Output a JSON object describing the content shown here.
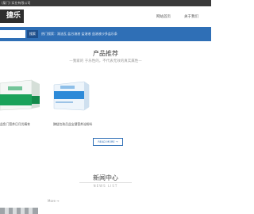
{
  "topbar": {
    "text": "(厦门) 实业有限公司"
  },
  "header": {
    "logo_text": "捷乐",
    "nav": [
      "网站首页",
      "关于我们"
    ]
  },
  "search": {
    "placeholder": "",
    "button_label": "搜索",
    "hot_text": "热门搜索：湖油瓦 盐谷溶液 盐溶液 益溶液沙多盐乐条"
  },
  "products": {
    "title": "产品推荐",
    "subtitle": "—我家的 于乐性的，不代表无效的真实属性—",
    "items": [
      {
        "name": "益鱼门营养日月优精育"
      },
      {
        "name": "酶链包装员益宝健营养淀粉料"
      }
    ],
    "read_more": "READ MORE →"
  },
  "news": {
    "title": "新闻中心",
    "subtitle": "NEWS LIST",
    "more": "More ➞"
  },
  "colors": {
    "accent": "#2f6fb6",
    "topbar": "#3a3a3a",
    "product_box_green": "#1aa25a",
    "product_box_blue": "#2d8ad8"
  }
}
